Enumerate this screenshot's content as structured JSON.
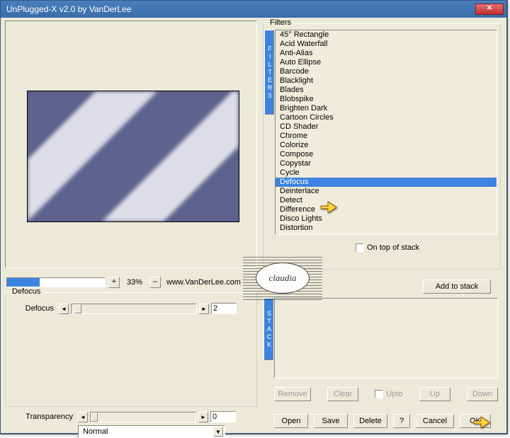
{
  "window": {
    "title": "UnPlugged-X v2.0 by VanDerLee"
  },
  "zoom": {
    "plus": "+",
    "value": "33%",
    "minus": "–",
    "fill_pct": 33,
    "url": "www.VanDerLee.com"
  },
  "defocus_group": {
    "label": "Defocus"
  },
  "defocus_slider": {
    "label": "Defocus",
    "value": "2"
  },
  "transparency": {
    "label": "Transparency",
    "value": "0"
  },
  "blend": {
    "value": "Normal"
  },
  "filters_group": {
    "label": "Filters",
    "vtab": "FILTERS"
  },
  "filters": {
    "items": [
      "45° Rectangle",
      "Acid Waterfall",
      "Anti-Alias",
      "Auto Ellipse",
      "Barcode",
      "Blacklight",
      "Blades",
      "Blobspike",
      "Brighten Dark",
      "Cartoon Circles",
      "CD Shader",
      "Chrome",
      "Colorize",
      "Compose",
      "Copystar",
      "Cycle",
      "Defocus",
      "Deinterlace",
      "Detect",
      "Difference",
      "Disco Lights",
      "Distortion"
    ],
    "selected_index": 16
  },
  "ontop": {
    "label": "On top of stack",
    "checked": false
  },
  "stack": {
    "add": "Add to stack",
    "vtab": "STACK",
    "remove": "Remove",
    "clear": "Clear",
    "upto": "Upto",
    "up": "Up",
    "down": "Down"
  },
  "bottom": {
    "open": "Open",
    "save": "Save",
    "delete": "Delete",
    "help": "?",
    "cancel": "Cancel",
    "ok": "OK"
  },
  "watermark": {
    "text": "claudia"
  }
}
